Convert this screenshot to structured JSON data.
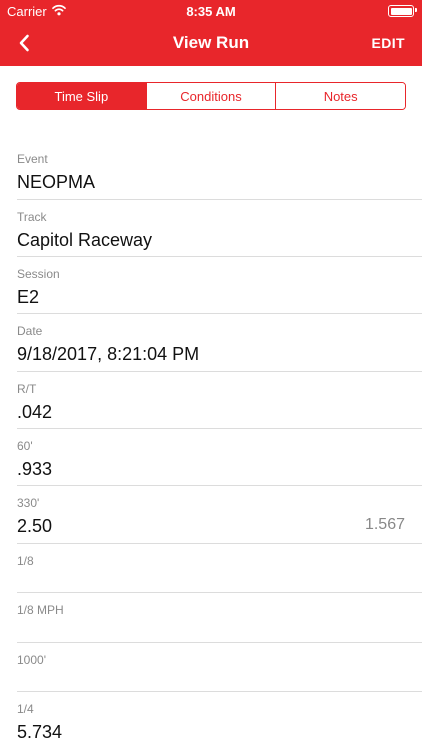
{
  "status_bar": {
    "carrier": "Carrier",
    "time": "8:35 AM"
  },
  "nav": {
    "title": "View Run",
    "edit_label": "EDIT"
  },
  "segments": [
    {
      "label": "Time Slip",
      "active": true
    },
    {
      "label": "Conditions",
      "active": false
    },
    {
      "label": "Notes",
      "active": false
    }
  ],
  "fields": [
    {
      "label": "Event",
      "value": "NEOPMA"
    },
    {
      "label": "Track",
      "value": "Capitol Raceway"
    },
    {
      "label": "Session",
      "value": "E2"
    },
    {
      "label": "Date",
      "value": "9/18/2017, 8:21:04 PM"
    },
    {
      "label": "R/T",
      "value": ".042"
    },
    {
      "label": "60'",
      "value": ".933"
    },
    {
      "label": "330'",
      "value": "2.50",
      "extra": "1.567"
    },
    {
      "label": "1/8",
      "value": ""
    },
    {
      "label": "1/8 MPH",
      "value": ""
    },
    {
      "label": "1000'",
      "value": ""
    },
    {
      "label": "1/4",
      "value": "5.734"
    }
  ],
  "colors": {
    "accent": "#e8262b"
  }
}
